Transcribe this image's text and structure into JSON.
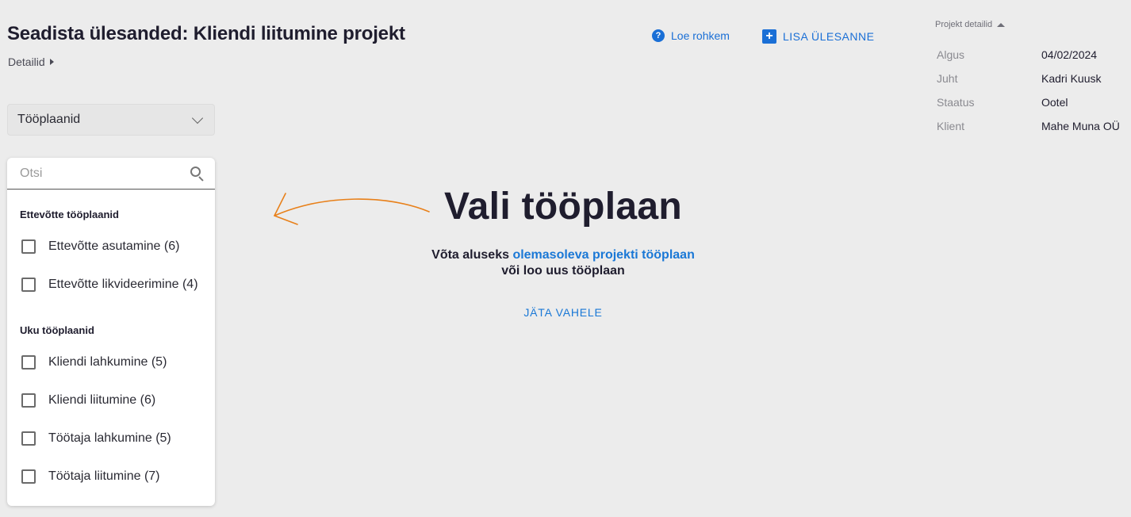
{
  "page": {
    "title": "Seadista ülesanded: Kliendi liitumine projekt",
    "details_label": "Detailid"
  },
  "toolbar": {
    "read_more_label": "Loe rohkem",
    "add_task_label": "LISA ÜLESANNE"
  },
  "project_details": {
    "header": "Projekt detailid",
    "rows": [
      {
        "key": "Algus",
        "value": "04/02/2024"
      },
      {
        "key": "Juht",
        "value": "Kadri Kuusk"
      },
      {
        "key": "Staatus",
        "value": "Ootel"
      },
      {
        "key": "Klient",
        "value": "Mahe Muna OÜ"
      }
    ]
  },
  "select": {
    "value": "Tööplaanid"
  },
  "panel": {
    "search_placeholder": "Otsi",
    "groups": [
      {
        "title": "Ettevõtte tööplaanid",
        "items": [
          {
            "label": "Ettevõtte asutamine (6)"
          },
          {
            "label": "Ettevõtte likvideerimine (4)"
          }
        ]
      },
      {
        "title": "Uku tööplaanid",
        "items": [
          {
            "label": "Kliendi lahkumine (5)"
          },
          {
            "label": "Kliendi liitumine (6)"
          },
          {
            "label": "Töötaja lahkumine (5)"
          },
          {
            "label": "Töötaja liitumine (7)"
          }
        ]
      }
    ]
  },
  "empty_state": {
    "title": "Vali tööplaan",
    "line1_prefix": "Võta aluseks ",
    "line1_link": "olemasoleva projekti tööplaan",
    "line2": "või loo uus tööplaan",
    "skip_label": "JÄTA VAHELE"
  },
  "colors": {
    "accent": "#1a78d6",
    "arrow": "#e8801a",
    "background": "#ececec"
  }
}
